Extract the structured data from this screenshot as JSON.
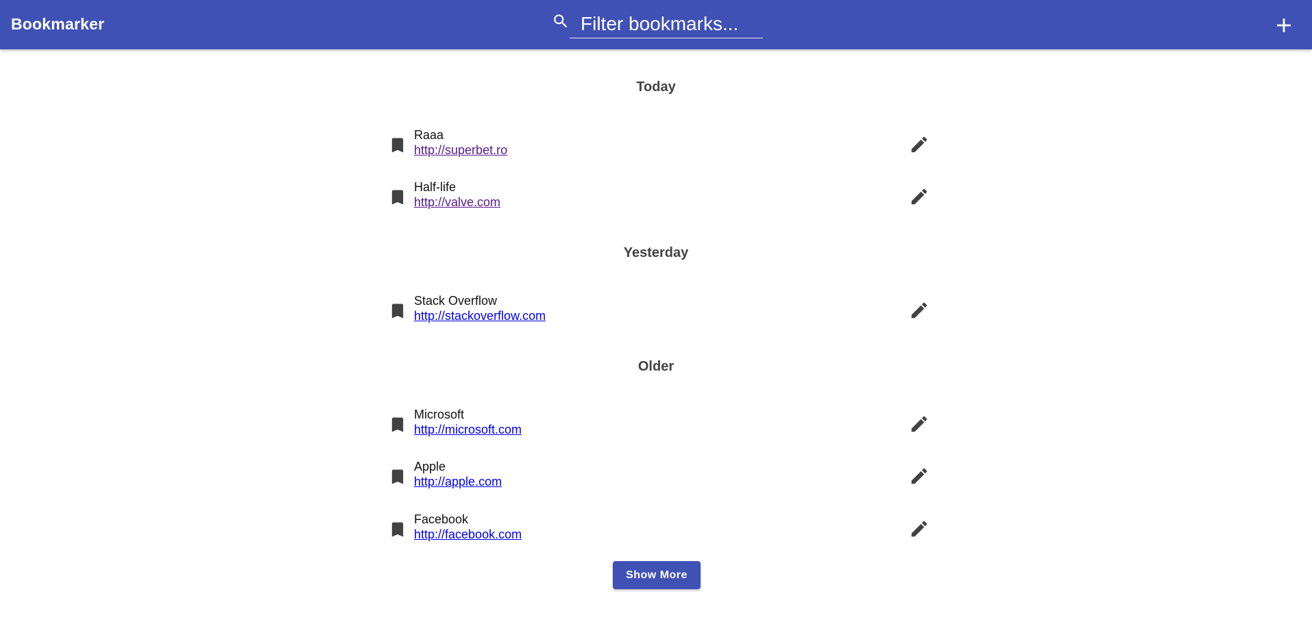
{
  "app": {
    "title": "Bookmarker"
  },
  "search": {
    "placeholder": "Filter bookmarks...",
    "value": "",
    "icon": "search-icon"
  },
  "toolbar": {
    "add_icon": "plus-icon",
    "accent_color": "#3f51b5"
  },
  "groups": [
    {
      "title": "Today",
      "items": [
        {
          "name": "Raaa",
          "url": "http://superbet.ro",
          "visited": true
        },
        {
          "name": "Half-life",
          "url": "http://valve.com",
          "visited": true
        }
      ]
    },
    {
      "title": "Yesterday",
      "items": [
        {
          "name": "Stack Overflow",
          "url": "http://stackoverflow.com",
          "visited": false
        }
      ]
    },
    {
      "title": "Older",
      "items": [
        {
          "name": "Microsoft",
          "url": "http://microsoft.com",
          "visited": false
        },
        {
          "name": "Apple",
          "url": "http://apple.com",
          "visited": false
        },
        {
          "name": "Facebook",
          "url": "http://facebook.com",
          "visited": false
        }
      ]
    }
  ],
  "footer": {
    "show_more_label": "Show More"
  }
}
